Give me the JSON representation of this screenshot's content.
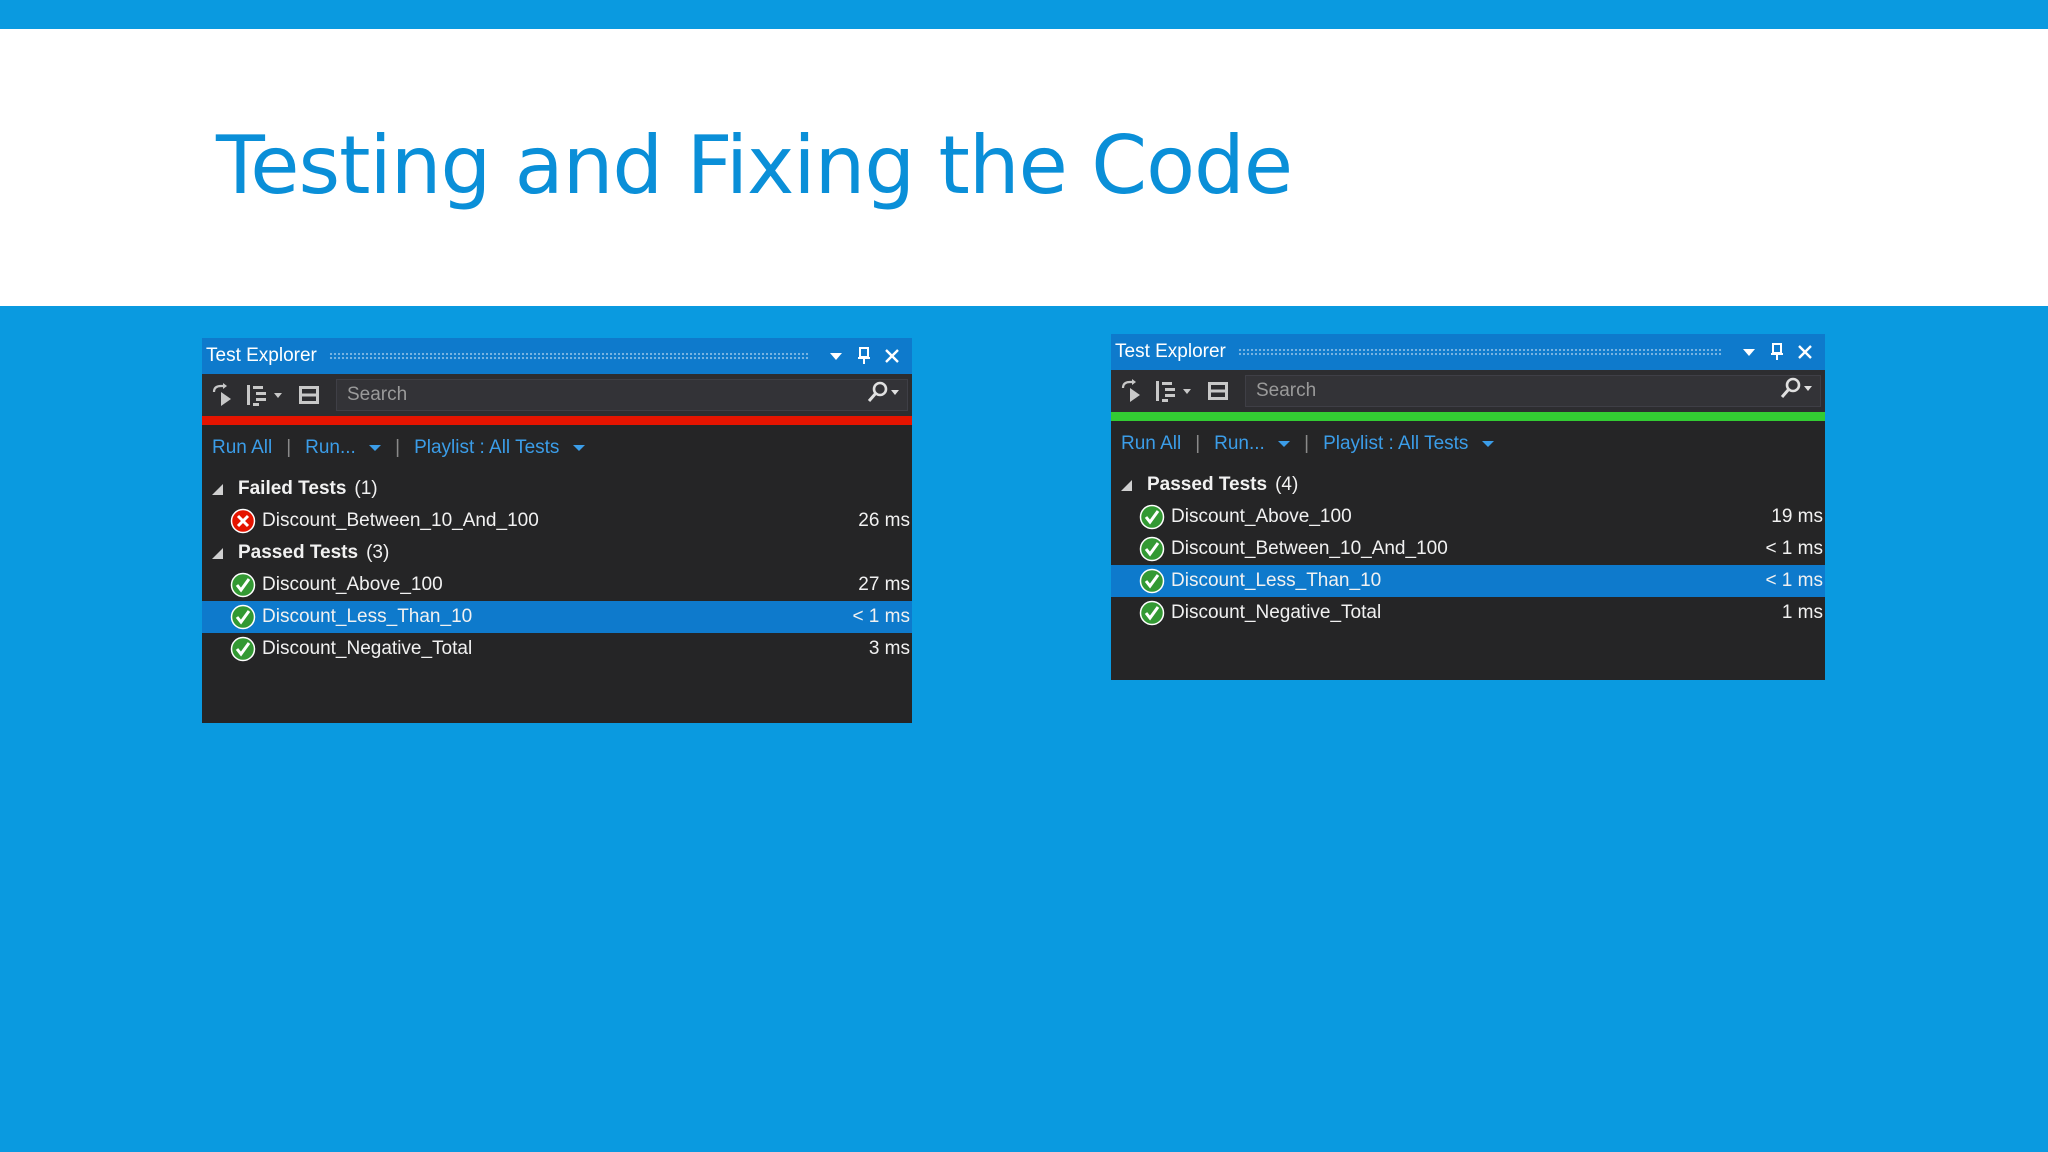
{
  "slide": {
    "title": "Testing and Fixing the Code"
  },
  "colors": {
    "slide_background": "#0a9ae0",
    "title_text": "#0a8fd8",
    "panel_background": "#252526",
    "titlebar_background": "#0e7acc",
    "link_text": "#3b9de8",
    "failed_bar": "#e51400",
    "passed_bar": "#33cc33",
    "selected_row": "#0e7acc"
  },
  "left_panel": {
    "title": "Test Explorer",
    "search_placeholder": "Search",
    "status": "failed",
    "actions": {
      "run_all": "Run All",
      "run": "Run...",
      "playlist": "Playlist : All Tests"
    },
    "groups": [
      {
        "name": "Failed Tests",
        "count": "(1)",
        "tests": [
          {
            "name": "Discount_Between_10_And_100",
            "duration": "26 ms",
            "result": "failed",
            "selected": false
          }
        ]
      },
      {
        "name": "Passed Tests",
        "count": "(3)",
        "tests": [
          {
            "name": "Discount_Above_100",
            "duration": "27 ms",
            "result": "passed",
            "selected": false
          },
          {
            "name": "Discount_Less_Than_10",
            "duration": "< 1 ms",
            "result": "passed",
            "selected": true
          },
          {
            "name": "Discount_Negative_Total",
            "duration": "3 ms",
            "result": "passed",
            "selected": false
          }
        ]
      }
    ]
  },
  "right_panel": {
    "title": "Test Explorer",
    "search_placeholder": "Search",
    "status": "passed",
    "actions": {
      "run_all": "Run All",
      "run": "Run...",
      "playlist": "Playlist : All Tests"
    },
    "groups": [
      {
        "name": "Passed Tests",
        "count": "(4)",
        "tests": [
          {
            "name": "Discount_Above_100",
            "duration": "19 ms",
            "result": "passed",
            "selected": false
          },
          {
            "name": "Discount_Between_10_And_100",
            "duration": "< 1 ms",
            "result": "passed",
            "selected": false
          },
          {
            "name": "Discount_Less_Than_10",
            "duration": "< 1 ms",
            "result": "passed",
            "selected": true
          },
          {
            "name": "Discount_Negative_Total",
            "duration": "1 ms",
            "result": "passed",
            "selected": false
          }
        ]
      }
    ]
  },
  "icons": {
    "titlebar": [
      "dropdown-arrow-icon",
      "pin-icon",
      "close-icon"
    ],
    "toolbar": [
      "run-tests-icon",
      "group-by-icon",
      "columns-icon",
      "search-icon"
    ],
    "tree": [
      "collapse-triangle-icon",
      "passed-check-icon",
      "failed-x-icon"
    ]
  }
}
